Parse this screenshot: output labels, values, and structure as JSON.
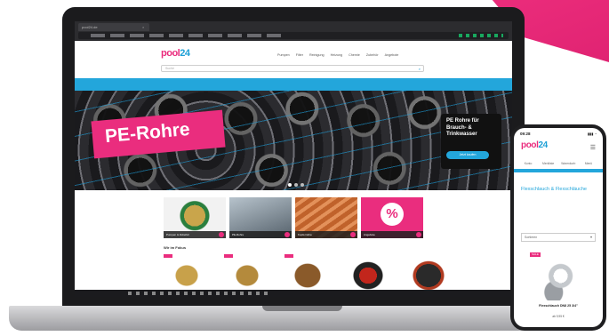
{
  "browser": {
    "tab_title": "pool24.de",
    "tab_close": "×"
  },
  "site": {
    "logo_main": "pool",
    "logo_num": "24",
    "search_placeholder": "Suche",
    "nav": [
      "Pumpen",
      "Filter",
      "Reinigung",
      "Heizung",
      "Chemie",
      "Zubehör",
      "Angebote"
    ],
    "hero_title": "PE-Rohre",
    "hero_box_text": "PE Rohre für Brauch- & Trinkwasser",
    "hero_cta": "Jetzt kaufen",
    "tiles": [
      {
        "label": "Pumpen & Zubehör"
      },
      {
        "label": "PE-Rohre"
      },
      {
        "label": "Kupferrohre"
      },
      {
        "label": "Angebote",
        "symbol": "%"
      }
    ],
    "section_title": "Wir im Fokus"
  },
  "phone": {
    "time": "09:28",
    "signal": "▮▮▮ ◔",
    "logo_main": "pool",
    "logo_num": "24",
    "menu_icon": "☰",
    "icons": [
      "Konto",
      "Merkliste",
      "Warenkorb",
      "Menü"
    ],
    "category_title": "Flexschlauch & Flexschläuche",
    "select_value": "Sortieren",
    "select_chevron": "▾",
    "sale": "SALE",
    "product_name": "Flexschlauch DN8 25 3/4\"",
    "product_price": "ab 9,95 €"
  },
  "colors": {
    "brand_pink": "#ea2d7e",
    "brand_blue": "#1d9fd6"
  }
}
